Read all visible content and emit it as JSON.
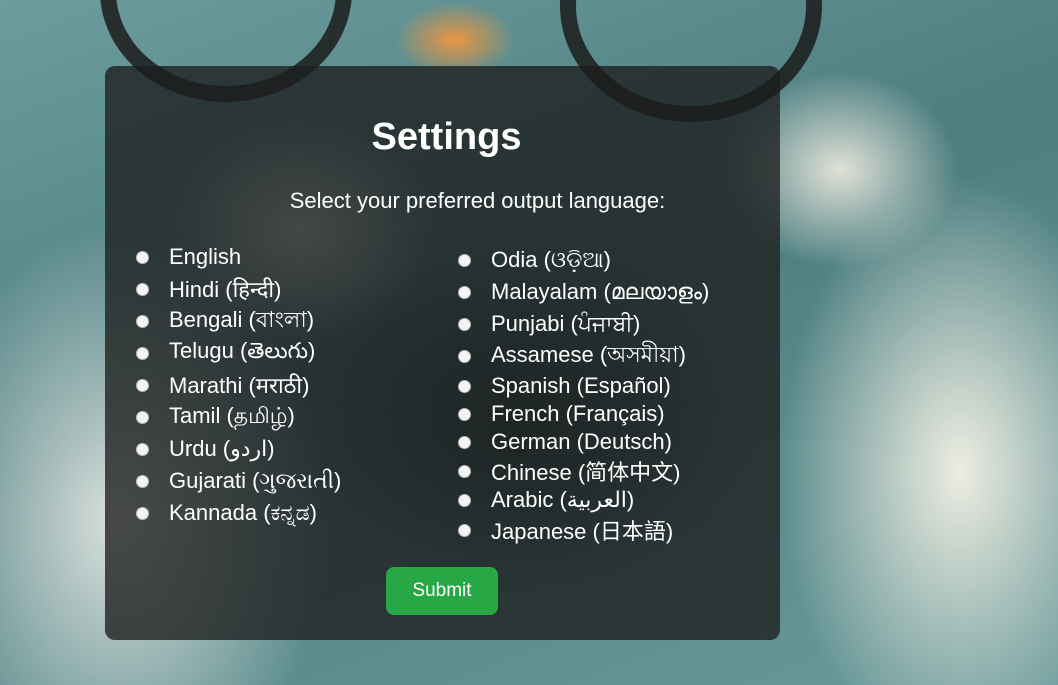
{
  "settings": {
    "title": "Settings",
    "prompt": "Select your preferred output language:",
    "submit_label": "Submit",
    "accent_color": "#28a745",
    "left_options": [
      "English",
      "Hindi (हिन्दी)",
      "Bengali (বাংলা)",
      "Telugu (తెలుగు)",
      "Marathi (मराठी)",
      "Tamil (தமிழ்)",
      "Urdu (اردو)",
      "Gujarati (ગુજરાતી)",
      "Kannada (ಕನ್ನಡ)"
    ],
    "right_options": [
      "Odia (ଓଡ଼ିଆ)",
      "Malayalam (മലയാളം)",
      "Punjabi (ਪੰਜਾਬੀ)",
      "Assamese (অসমীয়া)",
      "Spanish (Español)",
      "French (Français)",
      "German (Deutsch)",
      "Chinese (简体中文)",
      "Arabic (العربية)",
      "Japanese (日本語)"
    ]
  }
}
